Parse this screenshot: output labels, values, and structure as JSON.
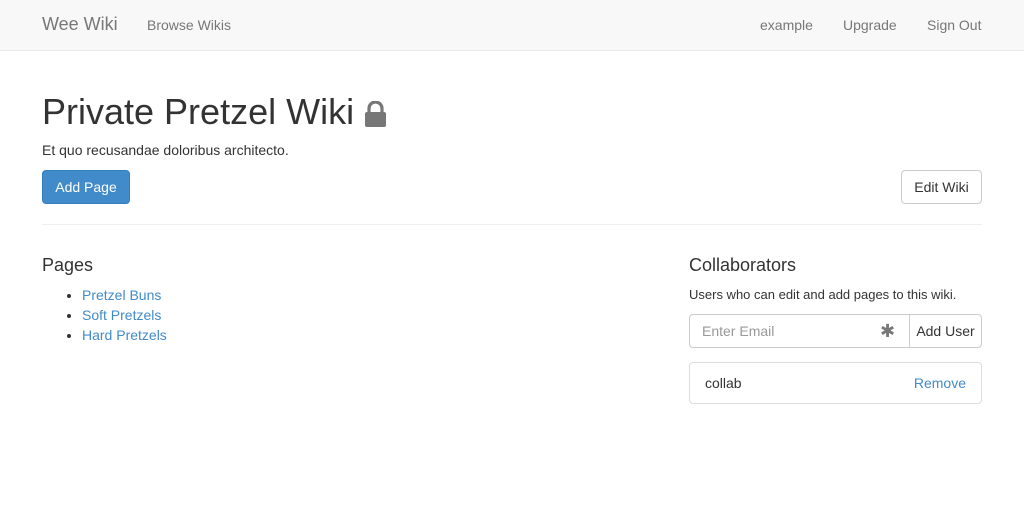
{
  "navbar": {
    "brand": "Wee Wiki",
    "browse": "Browse Wikis",
    "user": "example",
    "upgrade": "Upgrade",
    "sign_out": "Sign Out"
  },
  "header": {
    "title": "Private Pretzel Wiki",
    "lock_icon": "lock-icon",
    "description": "Et quo recusandae doloribus architecto.",
    "add_page_label": "Add Page",
    "edit_wiki_label": "Edit Wiki"
  },
  "pages": {
    "heading": "Pages",
    "items": [
      {
        "label": "Pretzel Buns"
      },
      {
        "label": "Soft Pretzels"
      },
      {
        "label": "Hard Pretzels"
      }
    ]
  },
  "collaborators": {
    "heading": "Collaborators",
    "description": "Users who can edit and add pages to this wiki.",
    "email_placeholder": "Enter Email",
    "required_marker": "✱",
    "add_user_label": "Add User",
    "items": [
      {
        "name": "collab",
        "remove_label": "Remove"
      }
    ]
  },
  "colors": {
    "primary": "#428bca",
    "navbar_bg": "#f8f8f8",
    "text": "#333333",
    "muted": "#777777"
  }
}
